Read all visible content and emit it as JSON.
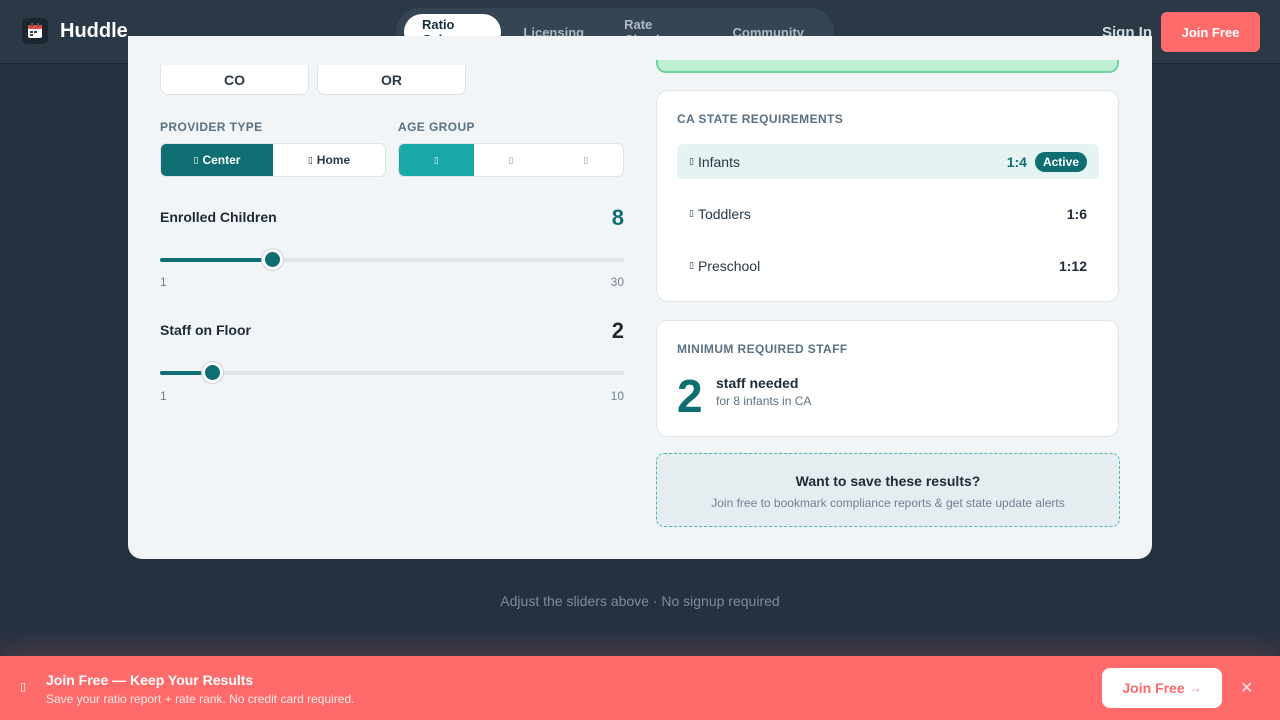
{
  "header": {
    "brand": "Huddle",
    "nav": [
      {
        "label": "Ratio Calc",
        "active": true
      },
      {
        "label": "Licensing",
        "active": false
      },
      {
        "label": "Rate Check",
        "active": false
      },
      {
        "label": "Community",
        "active": false
      }
    ],
    "sign_in": "Sign In",
    "join": "Join Free"
  },
  "states": [
    "CO",
    "OR"
  ],
  "provider_type": {
    "label": "PROVIDER TYPE",
    "options": [
      {
        "glyph": "▯",
        "label": "Center",
        "selected": true
      },
      {
        "glyph": "▯",
        "label": "Home",
        "selected": false
      }
    ]
  },
  "age_group": {
    "label": "AGE GROUP",
    "options": [
      {
        "glyph": "▯",
        "selected": true
      },
      {
        "glyph": "▯",
        "selected": false
      },
      {
        "glyph": "▯",
        "selected": false
      }
    ]
  },
  "enrolled": {
    "label": "Enrolled Children",
    "value": 8,
    "min": 1,
    "max": 30,
    "value_color": "#0e6e72"
  },
  "staff": {
    "label": "Staff on Floor",
    "value": 2,
    "min": 1,
    "max": 10,
    "value_color": "#1e2a36"
  },
  "requirements": {
    "title": "CA STATE REQUIREMENTS",
    "rows": [
      {
        "glyph": "▯",
        "name": "Infants",
        "ratio": "1:4",
        "badge": "Active",
        "active": true
      },
      {
        "glyph": "▯",
        "name": "Toddlers",
        "ratio": "1:6",
        "active": false
      },
      {
        "glyph": "▯",
        "name": "Preschool",
        "ratio": "1:12",
        "active": false
      }
    ]
  },
  "minimum": {
    "title": "MINIMUM REQUIRED STAFF",
    "count": "2",
    "label": "staff needed",
    "sub": "for 8 infants in CA"
  },
  "promo": {
    "title": "Want to save these results?",
    "sub": "Join free to bookmark compliance reports & get state update alerts"
  },
  "hint": "Adjust the sliders above · No signup required",
  "banner": {
    "icon": "▯",
    "title": "Join Free — Keep Your Results",
    "sub": "Save your ratio report + rate rank. No credit card required.",
    "button": "Join Free",
    "button_arrow": "→",
    "close": "✕"
  },
  "colors": {
    "accent": "#0e6e72",
    "teal": "#18a8a8",
    "coral": "#ff6b6b",
    "success": "#6fd39c"
  }
}
